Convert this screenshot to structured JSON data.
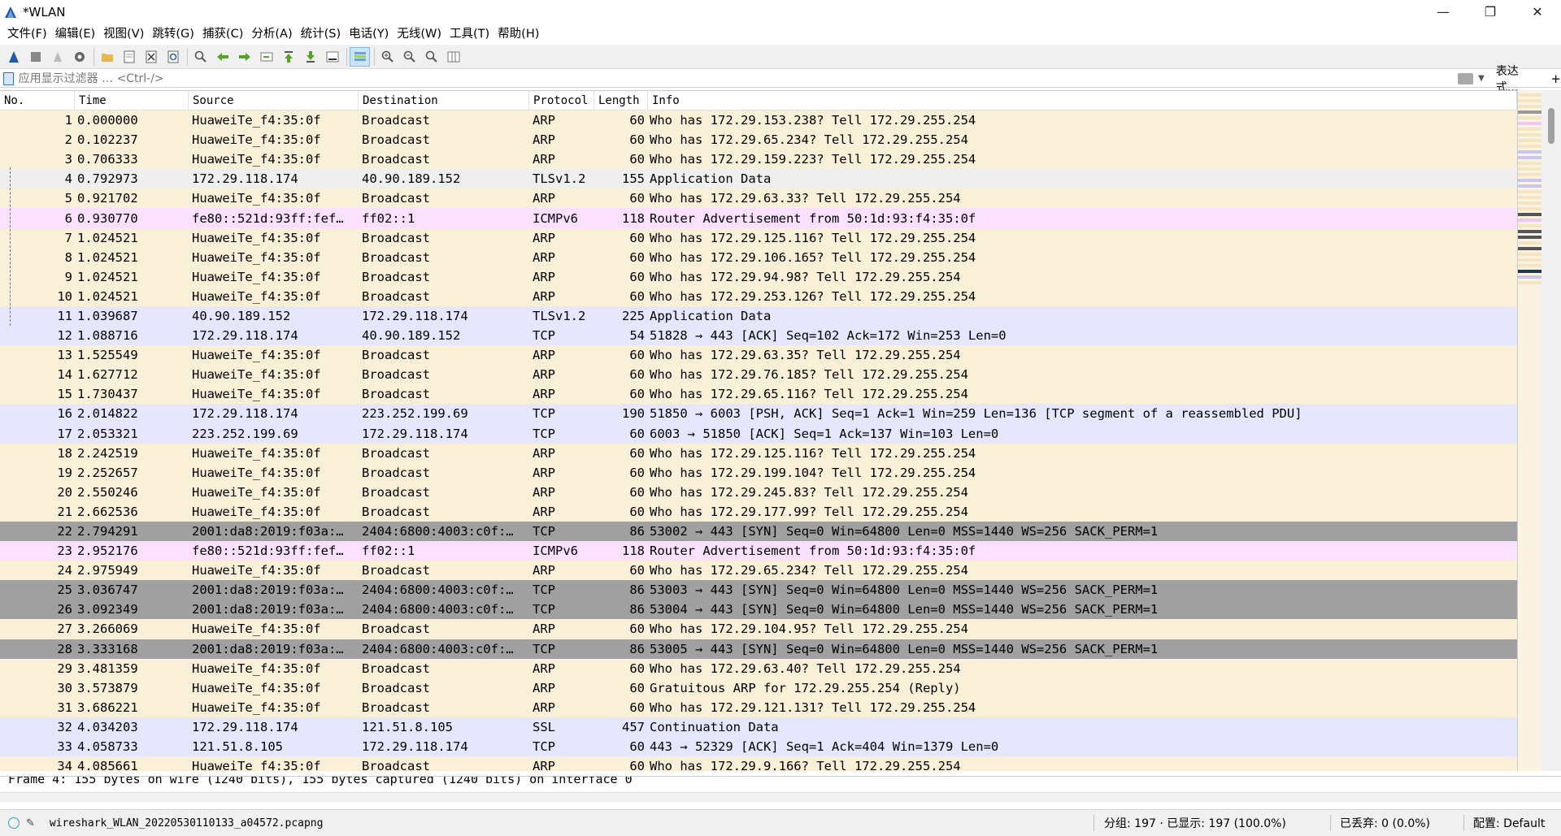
{
  "window": {
    "title": "*WLAN",
    "controls": [
      "—",
      "❐",
      "✕"
    ]
  },
  "menu": [
    "文件(F)",
    "编辑(E)",
    "视图(V)",
    "跳转(G)",
    "捕获(C)",
    "分析(A)",
    "统计(S)",
    "电话(Y)",
    "无线(W)",
    "工具(T)",
    "帮助(H)"
  ],
  "filter": {
    "placeholder": "应用显示过滤器 … <Ctrl-/>",
    "expression_label": "表达式…",
    "add_label": "+"
  },
  "columns": [
    "No.",
    "Time",
    "Source",
    "Destination",
    "Protocol",
    "Length",
    "Info"
  ],
  "packets": [
    {
      "no": "1",
      "time": "0.000000",
      "src": "HuaweiTe_f4:35:0f",
      "dst": "Broadcast",
      "proto": "ARP",
      "len": "60",
      "info": "Who has 172.29.153.238? Tell 172.29.255.254",
      "cls": "arp"
    },
    {
      "no": "2",
      "time": "0.102237",
      "src": "HuaweiTe_f4:35:0f",
      "dst": "Broadcast",
      "proto": "ARP",
      "len": "60",
      "info": "Who has 172.29.65.234? Tell 172.29.255.254",
      "cls": "arp"
    },
    {
      "no": "3",
      "time": "0.706333",
      "src": "HuaweiTe_f4:35:0f",
      "dst": "Broadcast",
      "proto": "ARP",
      "len": "60",
      "info": "Who has 172.29.159.223? Tell 172.29.255.254",
      "cls": "arp"
    },
    {
      "no": "4",
      "time": "0.792973",
      "src": "172.29.118.174",
      "dst": "40.90.189.152",
      "proto": "TLSv1.2",
      "len": "155",
      "info": "Application Data",
      "cls": "sel"
    },
    {
      "no": "5",
      "time": "0.921702",
      "src": "HuaweiTe_f4:35:0f",
      "dst": "Broadcast",
      "proto": "ARP",
      "len": "60",
      "info": "Who has 172.29.63.33? Tell 172.29.255.254",
      "cls": "arp"
    },
    {
      "no": "6",
      "time": "0.930770",
      "src": "fe80::521d:93ff:fef…",
      "dst": "ff02::1",
      "proto": "ICMPv6",
      "len": "118",
      "info": "Router Advertisement from 50:1d:93:f4:35:0f",
      "cls": "icmp"
    },
    {
      "no": "7",
      "time": "1.024521",
      "src": "HuaweiTe_f4:35:0f",
      "dst": "Broadcast",
      "proto": "ARP",
      "len": "60",
      "info": "Who has 172.29.125.116? Tell 172.29.255.254",
      "cls": "arp"
    },
    {
      "no": "8",
      "time": "1.024521",
      "src": "HuaweiTe_f4:35:0f",
      "dst": "Broadcast",
      "proto": "ARP",
      "len": "60",
      "info": "Who has 172.29.106.165? Tell 172.29.255.254",
      "cls": "arp"
    },
    {
      "no": "9",
      "time": "1.024521",
      "src": "HuaweiTe_f4:35:0f",
      "dst": "Broadcast",
      "proto": "ARP",
      "len": "60",
      "info": "Who has 172.29.94.98? Tell 172.29.255.254",
      "cls": "arp"
    },
    {
      "no": "10",
      "time": "1.024521",
      "src": "HuaweiTe_f4:35:0f",
      "dst": "Broadcast",
      "proto": "ARP",
      "len": "60",
      "info": "Who has 172.29.253.126? Tell 172.29.255.254",
      "cls": "arp"
    },
    {
      "no": "11",
      "time": "1.039687",
      "src": "40.90.189.152",
      "dst": "172.29.118.174",
      "proto": "TLSv1.2",
      "len": "225",
      "info": "Application Data",
      "cls": "tls"
    },
    {
      "no": "12",
      "time": "1.088716",
      "src": "172.29.118.174",
      "dst": "40.90.189.152",
      "proto": "TCP",
      "len": "54",
      "info": "51828 → 443 [ACK] Seq=102 Ack=172 Win=253 Len=0",
      "cls": "tcp"
    },
    {
      "no": "13",
      "time": "1.525549",
      "src": "HuaweiTe_f4:35:0f",
      "dst": "Broadcast",
      "proto": "ARP",
      "len": "60",
      "info": "Who has 172.29.63.35? Tell 172.29.255.254",
      "cls": "arp"
    },
    {
      "no": "14",
      "time": "1.627712",
      "src": "HuaweiTe_f4:35:0f",
      "dst": "Broadcast",
      "proto": "ARP",
      "len": "60",
      "info": "Who has 172.29.76.185? Tell 172.29.255.254",
      "cls": "arp"
    },
    {
      "no": "15",
      "time": "1.730437",
      "src": "HuaweiTe_f4:35:0f",
      "dst": "Broadcast",
      "proto": "ARP",
      "len": "60",
      "info": "Who has 172.29.65.116? Tell 172.29.255.254",
      "cls": "arp"
    },
    {
      "no": "16",
      "time": "2.014822",
      "src": "172.29.118.174",
      "dst": "223.252.199.69",
      "proto": "TCP",
      "len": "190",
      "info": "51850 → 6003 [PSH, ACK] Seq=1 Ack=1 Win=259 Len=136 [TCP segment of a reassembled PDU]",
      "cls": "tcp"
    },
    {
      "no": "17",
      "time": "2.053321",
      "src": "223.252.199.69",
      "dst": "172.29.118.174",
      "proto": "TCP",
      "len": "60",
      "info": "6003 → 51850 [ACK] Seq=1 Ack=137 Win=103 Len=0",
      "cls": "tcp"
    },
    {
      "no": "18",
      "time": "2.242519",
      "src": "HuaweiTe_f4:35:0f",
      "dst": "Broadcast",
      "proto": "ARP",
      "len": "60",
      "info": "Who has 172.29.125.116? Tell 172.29.255.254",
      "cls": "arp"
    },
    {
      "no": "19",
      "time": "2.252657",
      "src": "HuaweiTe_f4:35:0f",
      "dst": "Broadcast",
      "proto": "ARP",
      "len": "60",
      "info": "Who has 172.29.199.104? Tell 172.29.255.254",
      "cls": "arp"
    },
    {
      "no": "20",
      "time": "2.550246",
      "src": "HuaweiTe_f4:35:0f",
      "dst": "Broadcast",
      "proto": "ARP",
      "len": "60",
      "info": "Who has 172.29.245.83? Tell 172.29.255.254",
      "cls": "arp"
    },
    {
      "no": "21",
      "time": "2.662536",
      "src": "HuaweiTe_f4:35:0f",
      "dst": "Broadcast",
      "proto": "ARP",
      "len": "60",
      "info": "Who has 172.29.177.99? Tell 172.29.255.254",
      "cls": "arp"
    },
    {
      "no": "22",
      "time": "2.794291",
      "src": "2001:da8:2019:f03a:…",
      "dst": "2404:6800:4003:c0f:…",
      "proto": "TCP",
      "len": "86",
      "info": "53002 → 443 [SYN] Seq=0 Win=64800 Len=0 MSS=1440 WS=256 SACK_PERM=1",
      "cls": "syn"
    },
    {
      "no": "23",
      "time": "2.952176",
      "src": "fe80::521d:93ff:fef…",
      "dst": "ff02::1",
      "proto": "ICMPv6",
      "len": "118",
      "info": "Router Advertisement from 50:1d:93:f4:35:0f",
      "cls": "icmp"
    },
    {
      "no": "24",
      "time": "2.975949",
      "src": "HuaweiTe_f4:35:0f",
      "dst": "Broadcast",
      "proto": "ARP",
      "len": "60",
      "info": "Who has 172.29.65.234? Tell 172.29.255.254",
      "cls": "arp"
    },
    {
      "no": "25",
      "time": "3.036747",
      "src": "2001:da8:2019:f03a:…",
      "dst": "2404:6800:4003:c0f:…",
      "proto": "TCP",
      "len": "86",
      "info": "53003 → 443 [SYN] Seq=0 Win=64800 Len=0 MSS=1440 WS=256 SACK_PERM=1",
      "cls": "syn"
    },
    {
      "no": "26",
      "time": "3.092349",
      "src": "2001:da8:2019:f03a:…",
      "dst": "2404:6800:4003:c0f:…",
      "proto": "TCP",
      "len": "86",
      "info": "53004 → 443 [SYN] Seq=0 Win=64800 Len=0 MSS=1440 WS=256 SACK_PERM=1",
      "cls": "syn"
    },
    {
      "no": "27",
      "time": "3.266069",
      "src": "HuaweiTe_f4:35:0f",
      "dst": "Broadcast",
      "proto": "ARP",
      "len": "60",
      "info": "Who has 172.29.104.95? Tell 172.29.255.254",
      "cls": "arp"
    },
    {
      "no": "28",
      "time": "3.333168",
      "src": "2001:da8:2019:f03a:…",
      "dst": "2404:6800:4003:c0f:…",
      "proto": "TCP",
      "len": "86",
      "info": "53005 → 443 [SYN] Seq=0 Win=64800 Len=0 MSS=1440 WS=256 SACK_PERM=1",
      "cls": "syn"
    },
    {
      "no": "29",
      "time": "3.481359",
      "src": "HuaweiTe_f4:35:0f",
      "dst": "Broadcast",
      "proto": "ARP",
      "len": "60",
      "info": "Who has 172.29.63.40? Tell 172.29.255.254",
      "cls": "arp"
    },
    {
      "no": "30",
      "time": "3.573879",
      "src": "HuaweiTe_f4:35:0f",
      "dst": "Broadcast",
      "proto": "ARP",
      "len": "60",
      "info": "Gratuitous ARP for 172.29.255.254 (Reply)",
      "cls": "arp"
    },
    {
      "no": "31",
      "time": "3.686221",
      "src": "HuaweiTe_f4:35:0f",
      "dst": "Broadcast",
      "proto": "ARP",
      "len": "60",
      "info": "Who has 172.29.121.131? Tell 172.29.255.254",
      "cls": "arp"
    },
    {
      "no": "32",
      "time": "4.034203",
      "src": "172.29.118.174",
      "dst": "121.51.8.105",
      "proto": "SSL",
      "len": "457",
      "info": "Continuation Data",
      "cls": "ssl"
    },
    {
      "no": "33",
      "time": "4.058733",
      "src": "121.51.8.105",
      "dst": "172.29.118.174",
      "proto": "TCP",
      "len": "60",
      "info": "443 → 52329 [ACK] Seq=1 Ack=404 Win=1379 Len=0",
      "cls": "tcp"
    },
    {
      "no": "34",
      "time": "4.085661",
      "src": "HuaweiTe_f4:35:0f",
      "dst": "Broadcast",
      "proto": "ARP",
      "len": "60",
      "info": "Who has 172.29.9.166? Tell 172.29.255.254",
      "cls": "arp"
    }
  ],
  "detail": {
    "line": "Frame 4: 155 bytes on wire (1240 bits), 155 bytes captured (1240 bits) on interface 0"
  },
  "status": {
    "file": "wireshark_WLAN_20220530110133_a04572.pcapng",
    "stats": "分组: 197 · 已显示: 197 (100.0%)",
    "dropped": "已丢弃: 0 (0.0%)",
    "profile": "配置: Default"
  },
  "colors": {
    "arp": "#faf0d7",
    "tcp": "#e7e6ff",
    "icmp": "#fce0ff",
    "syn": "#a0a0a0",
    "selected": "#efefef",
    "accent": "#1e5aa8"
  }
}
